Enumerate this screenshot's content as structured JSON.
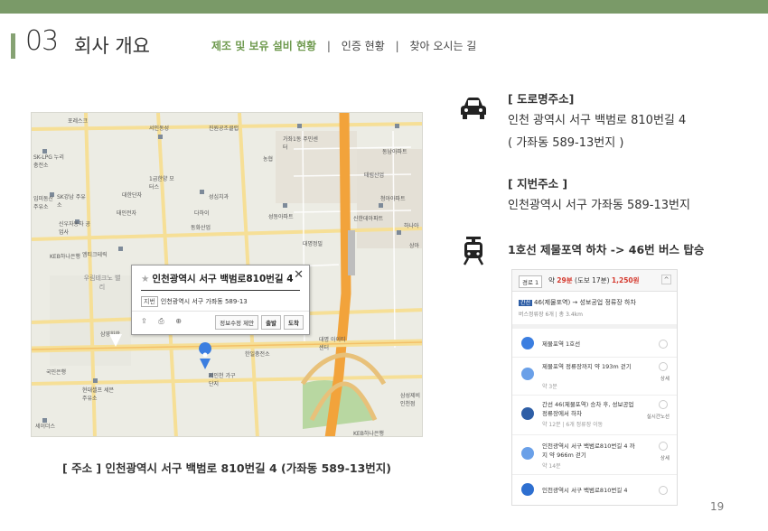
{
  "header": {
    "section_number": "03",
    "section_title": "회사 개요",
    "nav": [
      {
        "label": "제조 및 보유 설비 현황",
        "active": true
      },
      {
        "label": "인증 현황",
        "active": false
      },
      {
        "label": "찾아 오시는 길",
        "active": false
      }
    ],
    "nav_separator": "|"
  },
  "map": {
    "labels": [
      "포레스크",
      "서인동성",
      "진원공조클럽",
      "가좌1동 주민센터",
      "농협",
      "동남아파트",
      "SK-LPG 누리충전소",
      "1급한양 모터스",
      "대한단자",
      "태림산업",
      "SK강남 주유소",
      "입미동산 주유소",
      "성심치과",
      "다하이",
      "태인전자",
      "성동아파트",
      "신한데아파트",
      "청아아파트",
      "하나아",
      "신우자동차 공업사",
      "동화산업",
      "대명정밀",
      "상아",
      "KEB하나은행",
      "엠티크테릭",
      "우림테크노 밸리",
      "삼영화학",
      "한일충전소",
      "대명 아이티센터",
      "국민은행",
      "현대셀프 세븐주유소",
      "서인천 가구단지",
      "삼성제비 인천점",
      "세이더스",
      "KEB하나은행"
    ],
    "popup": {
      "title": "인천광역시 서구 백범로810번길 4",
      "jibun_tag": "지번",
      "jibun_text": "인천광역시 서구 가좌동 589-13",
      "report_button": "정보수정 제안",
      "start_button": "출발",
      "arrive_button": "도착"
    }
  },
  "caption": "[ 주소 ] 인천광역시 서구 백범로 810번길  4 (가좌동 589-13번지)",
  "address": {
    "road_heading": "[ 도로명주소]",
    "road_line1": "인천 광역시 서구 백범로 810번길 4",
    "road_line2": "( 가좌동 589-13번지 )",
    "jibun_heading": "[ 지번주소 ]",
    "jibun_line": "인천광역시 서구 가좌동  589-13번지",
    "transit_heading": "1호선 제물포역 하차 -> 46번 버스 탑승"
  },
  "route": {
    "badge": "경로 1",
    "summary_prefix": "약",
    "duration": "29분",
    "walk": "(도보 17분)",
    "fare": "1,250원",
    "bus_number": "간선",
    "bus_line": "46(제물포역) → 성보공업 정류장 하차",
    "bus_sub": "버스정류장 6개 | 총 3.4km",
    "steps": [
      {
        "text": "제물포역 1호선",
        "sub": "",
        "btn": ""
      },
      {
        "text": "제물포역 정류장까지 약 193m 걷기",
        "sub": "약 3분",
        "btn": "상세"
      },
      {
        "text": "간선 46(제물포역) 승차 후, 성보공업 정류장에서 하차",
        "sub": "약 12분 | 6개 정류장 이동",
        "btn": "실시간노선"
      },
      {
        "text": "인천광역시 서구 백범로810번길 4 까지 약 966m 걷기",
        "sub": "약 14분",
        "btn": "상세"
      },
      {
        "text": "인천광역시 서구 백범로810번길 4",
        "sub": "",
        "btn": ""
      }
    ]
  },
  "page_number": "19",
  "colors": {
    "topbar": "#7a9a68",
    "accent": "#6f9a4f",
    "road_major": "#f2a33b",
    "road_minor": "#f6df96",
    "pin": "#3b7ee0"
  }
}
